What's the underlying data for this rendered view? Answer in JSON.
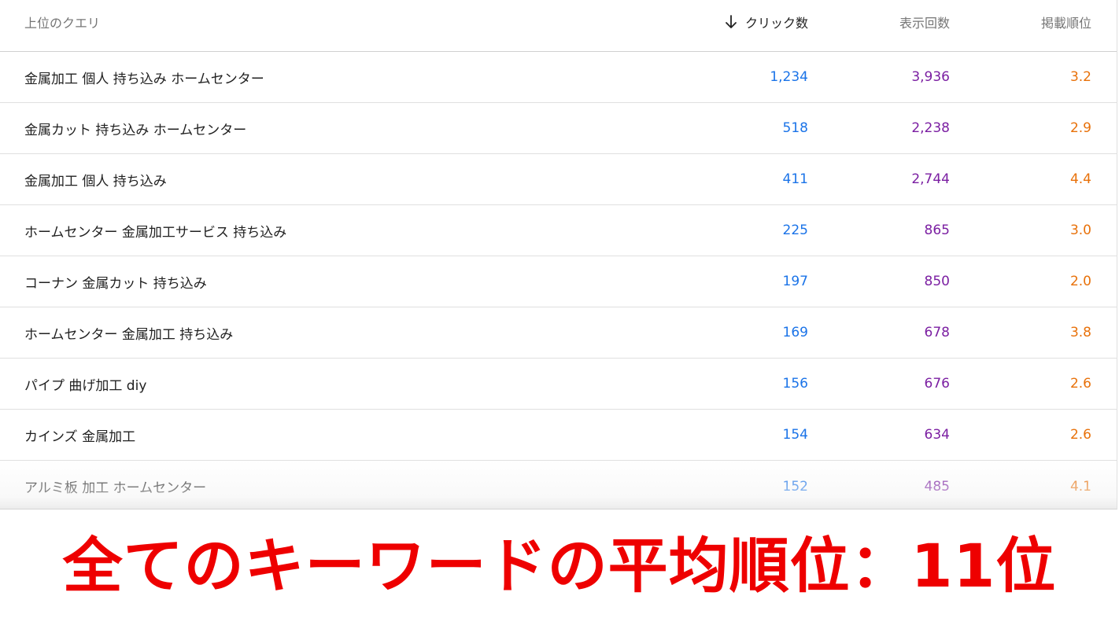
{
  "table": {
    "headers": {
      "query": "上位のクエリ",
      "clicks": "クリック数",
      "impressions": "表示回数",
      "position": "掲載順位"
    },
    "sort_icon": "arrow-down-icon",
    "rows": [
      {
        "query": "金属加工 個人 持ち込み ホームセンター",
        "clicks": "1,234",
        "impressions": "3,936",
        "position": "3.2"
      },
      {
        "query": "金属カット 持ち込み ホームセンター",
        "clicks": "518",
        "impressions": "2,238",
        "position": "2.9"
      },
      {
        "query": "金属加工 個人 持ち込み",
        "clicks": "411",
        "impressions": "2,744",
        "position": "4.4"
      },
      {
        "query": "ホームセンター 金属加工サービス 持ち込み",
        "clicks": "225",
        "impressions": "865",
        "position": "3.0"
      },
      {
        "query": "コーナン 金属カット 持ち込み",
        "clicks": "197",
        "impressions": "850",
        "position": "2.0"
      },
      {
        "query": "ホームセンター 金属加工 持ち込み",
        "clicks": "169",
        "impressions": "678",
        "position": "3.8"
      },
      {
        "query": "パイプ 曲げ加工 diy",
        "clicks": "156",
        "impressions": "676",
        "position": "2.6"
      },
      {
        "query": "カインズ 金属加工",
        "clicks": "154",
        "impressions": "634",
        "position": "2.6"
      },
      {
        "query": "アルミ板 加工 ホームセンター",
        "clicks": "152",
        "impressions": "485",
        "position": "4.1"
      }
    ]
  },
  "caption": "全てのキーワードの平均順位：11位",
  "colors": {
    "clicks": "#1a73e8",
    "impressions": "#7b1fa2",
    "position": "#e8710a",
    "caption": "#ee0000"
  }
}
